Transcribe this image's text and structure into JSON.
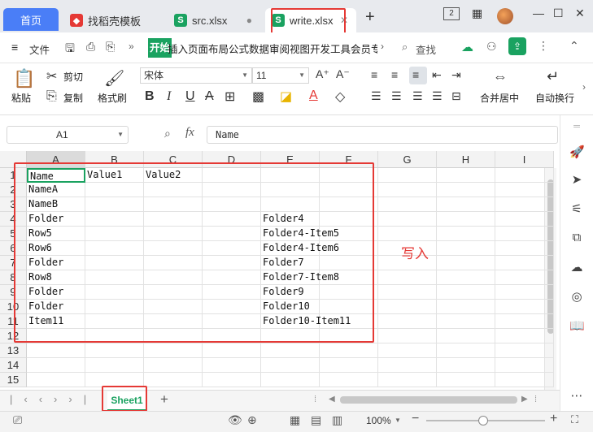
{
  "tabs": [
    {
      "label": "首页",
      "icon": "home"
    },
    {
      "label": "找稻壳模板",
      "icon": "docer-icon"
    },
    {
      "label": "src.xlsx",
      "icon": "spreadsheet-icon"
    },
    {
      "label": "write.xlsx",
      "icon": "spreadsheet-icon",
      "active": true
    }
  ],
  "window": {
    "badge": "2"
  },
  "menu": {
    "file": "文件",
    "ribbon_tabs": "开始插入页面布局公式数据审阅视图开发工具会员专享",
    "start_tab": "开始",
    "rest_tabs": "插入页面布局公式数据审阅视图开发工具会员专享",
    "search": "查找"
  },
  "toolbar": {
    "paste": "粘贴",
    "cut": "剪切",
    "copy": "复制",
    "format_painter": "格式刷",
    "font_name": "宋体",
    "font_size": "11",
    "merge_center": "合并居中",
    "auto_wrap": "自动换行"
  },
  "formula": {
    "cell_ref": "A1",
    "fx": "fx",
    "value": "Name"
  },
  "columns": [
    "A",
    "B",
    "C",
    "D",
    "E",
    "F",
    "G",
    "H",
    "I"
  ],
  "rows": [
    "1",
    "2",
    "3",
    "4",
    "5",
    "6",
    "7",
    "8",
    "9",
    "10",
    "11",
    "12",
    "13",
    "14",
    "15"
  ],
  "cells": {
    "r1": [
      "Name",
      "Value1",
      "Value2",
      "",
      "",
      ""
    ],
    "r2": [
      "NameA",
      "",
      "",
      "",
      "",
      ""
    ],
    "r3": [
      "NameB",
      "",
      "",
      "",
      "",
      ""
    ],
    "r4": [
      "Folder",
      "",
      "",
      "",
      "Folder4",
      ""
    ],
    "r5": [
      "Row5",
      "",
      "",
      "",
      "Folder4-Item5",
      ""
    ],
    "r6": [
      "Row6",
      "",
      "",
      "",
      "Folder4-Item6",
      ""
    ],
    "r7": [
      "Folder",
      "",
      "",
      "",
      "Folder7",
      ""
    ],
    "r8": [
      "Row8",
      "",
      "",
      "",
      "Folder7-Item8",
      ""
    ],
    "r9": [
      "Folder",
      "",
      "",
      "",
      "Folder9",
      ""
    ],
    "r10": [
      "Folder",
      "",
      "",
      "",
      "Folder10",
      ""
    ],
    "r11": [
      "Item11",
      "",
      "",
      "",
      "Folder10-Item11",
      ""
    ]
  },
  "annotation": "写入",
  "sheet": {
    "name": "Sheet1"
  },
  "status": {
    "zoom": "100%"
  },
  "colors": {
    "accent": "#1aa260",
    "brand": "#4a7ef7",
    "highlight": "#e53935"
  }
}
